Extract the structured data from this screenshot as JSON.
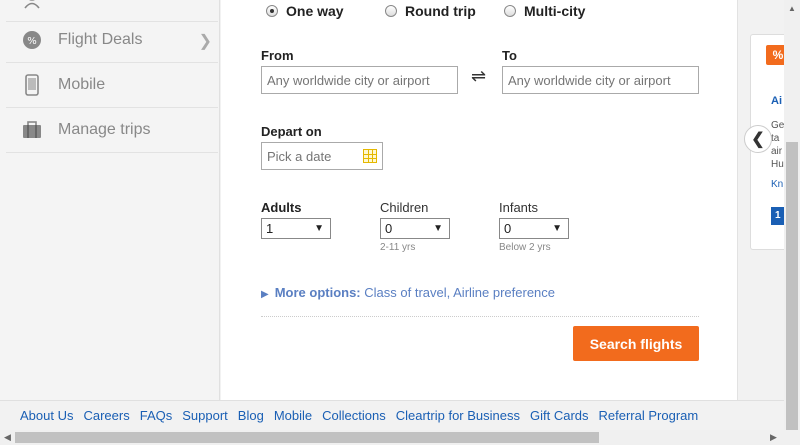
{
  "sidebar": {
    "items": [
      {
        "label": "",
        "icon": "user-icon"
      },
      {
        "label": "Flight Deals",
        "icon": "deals-icon"
      },
      {
        "label": "Mobile",
        "icon": "mobile-icon"
      },
      {
        "label": "Manage trips",
        "icon": "briefcase-icon"
      }
    ]
  },
  "trip_type": {
    "options": [
      "One way",
      "Round trip",
      "Multi-city"
    ],
    "selected": "One way"
  },
  "form": {
    "from_label": "From",
    "from_placeholder": "Any worldwide city or airport",
    "to_label": "To",
    "to_placeholder": "Any worldwide city or airport",
    "swap_glyph": "⇌",
    "depart_label": "Depart on",
    "depart_placeholder": "Pick a date",
    "adults_label": "Adults",
    "adults_value": "1",
    "children_label": "Children",
    "children_value": "0",
    "children_hint": "2-11 yrs",
    "infants_label": "Infants",
    "infants_value": "0",
    "infants_hint": "Below 2 yrs",
    "more_options_label": "More options:",
    "more_options_value": "Class of travel, Airline preference",
    "search_label": "Search flights"
  },
  "promo": {
    "badge": "%",
    "title": "Ai",
    "text": [
      "Ge",
      " ta",
      "air",
      "Hu"
    ],
    "link": "Kn",
    "button": "1"
  },
  "footer": {
    "links": [
      "About Us",
      "Careers",
      "FAQs",
      "Support",
      "Blog",
      "Mobile",
      "Collections",
      "Cleartrip for Business",
      "Gift Cards",
      "Referral Program"
    ]
  },
  "colors": {
    "accent": "#f26b1d",
    "link": "#1a5fb4",
    "more_options": "#5a7fc2"
  }
}
